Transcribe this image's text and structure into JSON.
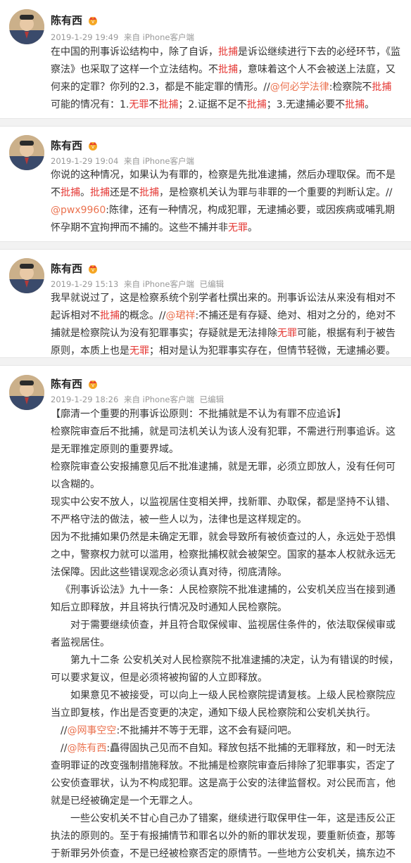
{
  "user": {
    "name": "陈有西",
    "vip_icon": "vip-crown-icon",
    "avatar_icon": "user-avatar"
  },
  "posts": [
    {
      "time": "2019-1-29 19:49",
      "source": "来自 iPhone客户端",
      "edited": "",
      "paragraphs": [
        [
          {
            "t": "在中国的刑事诉讼结构中，除了自诉，"
          },
          {
            "t": "批捕",
            "c": "red"
          },
          {
            "t": "是诉讼继续进行下去的必经环节，《监察法》也采取了这样一个立法结构。不"
          },
          {
            "t": "批捕",
            "c": "red"
          },
          {
            "t": "，意味着这个人不会被送上法庭，又何来的定罪？你列的2.3，都是不能定罪的情形。//"
          },
          {
            "t": "@何必学法律",
            "c": "at"
          },
          {
            "t": ":检察院不"
          },
          {
            "t": "批捕",
            "c": "red"
          },
          {
            "t": "可能的情况有：1."
          },
          {
            "t": "无罪",
            "c": "red"
          },
          {
            "t": "不"
          },
          {
            "t": "批捕",
            "c": "red"
          },
          {
            "t": "；2.证据不足不"
          },
          {
            "t": "批捕",
            "c": "red"
          },
          {
            "t": "；3.无逮捕必要不"
          },
          {
            "t": "批捕",
            "c": "red"
          },
          {
            "t": "。"
          }
        ]
      ]
    },
    {
      "time": "2019-1-29 19:04",
      "source": "来自 iPhone客户端",
      "edited": "",
      "paragraphs": [
        [
          {
            "t": "你说的这种情况，如果认为有罪的，检察是先批准逮捕，然后办理取保。而不是不"
          },
          {
            "t": "批捕",
            "c": "red"
          },
          {
            "t": "。"
          },
          {
            "t": "批捕",
            "c": "red"
          },
          {
            "t": "还是不"
          },
          {
            "t": "批捕",
            "c": "red"
          },
          {
            "t": "，是检察机关认为罪与非罪的一个重要的判断认定。//"
          },
          {
            "t": "@pwx9960",
            "c": "at"
          },
          {
            "t": ":陈律，还有一种情况，构成犯罪，无逮捕必要，或因疾病或哺乳期怀孕期不宜拘押而不捕的。这些不捕并非"
          },
          {
            "t": "无罪",
            "c": "red"
          },
          {
            "t": "。"
          }
        ]
      ]
    },
    {
      "time": "2019-1-29 15:13",
      "source": "来自 iPhone客户端",
      "edited": "已编辑",
      "paragraphs": [
        [
          {
            "t": "我早就说过了，这是检察系统个别学者杜撰出来的。刑事诉讼法从来没有相对不起诉相对不"
          },
          {
            "t": "批捕",
            "c": "red"
          },
          {
            "t": "的概念。//"
          },
          {
            "t": "@珺祥",
            "c": "at"
          },
          {
            "t": ":不捕还是有存疑、绝对、相对之分的，绝对不捕就是检察院认为没有犯罪事实；存疑就是无法排除"
          },
          {
            "t": "无罪",
            "c": "red"
          },
          {
            "t": "可能，根据有利于被告原则，本质上也是"
          },
          {
            "t": "无罪",
            "c": "red"
          },
          {
            "t": "；相对是认为犯罪事实存在，但情节轻微，无逮捕必要。"
          }
        ]
      ]
    },
    {
      "time": "2019-1-29 18:26",
      "source": "来自 iPhone客户端",
      "edited": "已编辑",
      "paragraphs": [
        [
          {
            "t": "【廓清一个重要的刑事诉讼原则：不批捕就是不认为有罪不应追诉】"
          }
        ],
        [
          {
            "t": "检察院审查后不批捕，就是司法机关认为该人没有犯罪，不需进行刑事追诉。这是无罪推定原则的重要界域。"
          }
        ],
        [
          {
            "t": "检察院审查公安报捕意见后不批准逮捕，就是无罪，必须立即放人，没有任何可以含糊的。"
          }
        ],
        [
          {
            "t": "现实中公安不放人，以监视居住变相关押，找新罪、办取保，都是坚持不认错、不严格守法的做法，被一些人以为，法律也是这样规定的。"
          }
        ],
        [
          {
            "t": "因为不批捕如果仍然是未确定无罪，就会导致所有被侦查过的人，永远处于恐惧之中，警察权力就可以滥用，检察批捕权就会被架空。国家的基本人权就永远无法保障。因此这些错误观念必须认真对待，彻底清除。"
          }
        ],
        [
          {
            "t": "《刑事诉讼法》九十一条：人民检察院不批准逮捕的，公安机关应当在接到通知后立即释放，并且将执行情况及时通知人民检察院。"
          }
        ],
        [
          {
            "t": "对于需要继续侦查，并且符合取保候审、监视居住条件的，依法取保候审或者监视居住。"
          }
        ],
        [
          {
            "t": "第九十二条 公安机关对人民检察院不批准逮捕的决定，认为有错误的时候，可以要求复议，但是必须将被拘留的人立即释放。"
          }
        ],
        [
          {
            "t": "如果意见不被接受，可以向上一级人民检察院提请复核。上级人民检察院应当立即复核，作出是否变更的决定，通知下级人民检察院和公安机关执行。"
          }
        ],
        [
          {
            "t": "//"
          },
          {
            "t": "@网事空空",
            "c": "at"
          },
          {
            "t": ":不批捕并不等于无罪，这不会有疑问吧。"
          }
        ],
        [
          {
            "t": "//"
          },
          {
            "t": "@陈有西",
            "c": "at"
          },
          {
            "t": ":矗得固执己见而不自知。释放包括不批捕的无罪释放，和一时无法查明罪证的改变强制措施释放。不批捕是检察院审查后排除了犯罪事实，否定了公安侦查罪状，认为不构成犯罪。这是高于公安的法律监督权。对公民而言，他就是已经被确定是一个无罪之人。"
          }
        ],
        [
          {
            "t": "一些公安机关不甘心自己办了错案，继续进行取保甲住一年，这是违反公正执法的原则的。至于有报捕情节和罪名以外的新的罪状发现，要重新侦查，那等于新罪另外侦查，不是已经被检察否定的原情节。一些地方公安机关，搞东边不"
          }
        ]
      ]
    }
  ]
}
